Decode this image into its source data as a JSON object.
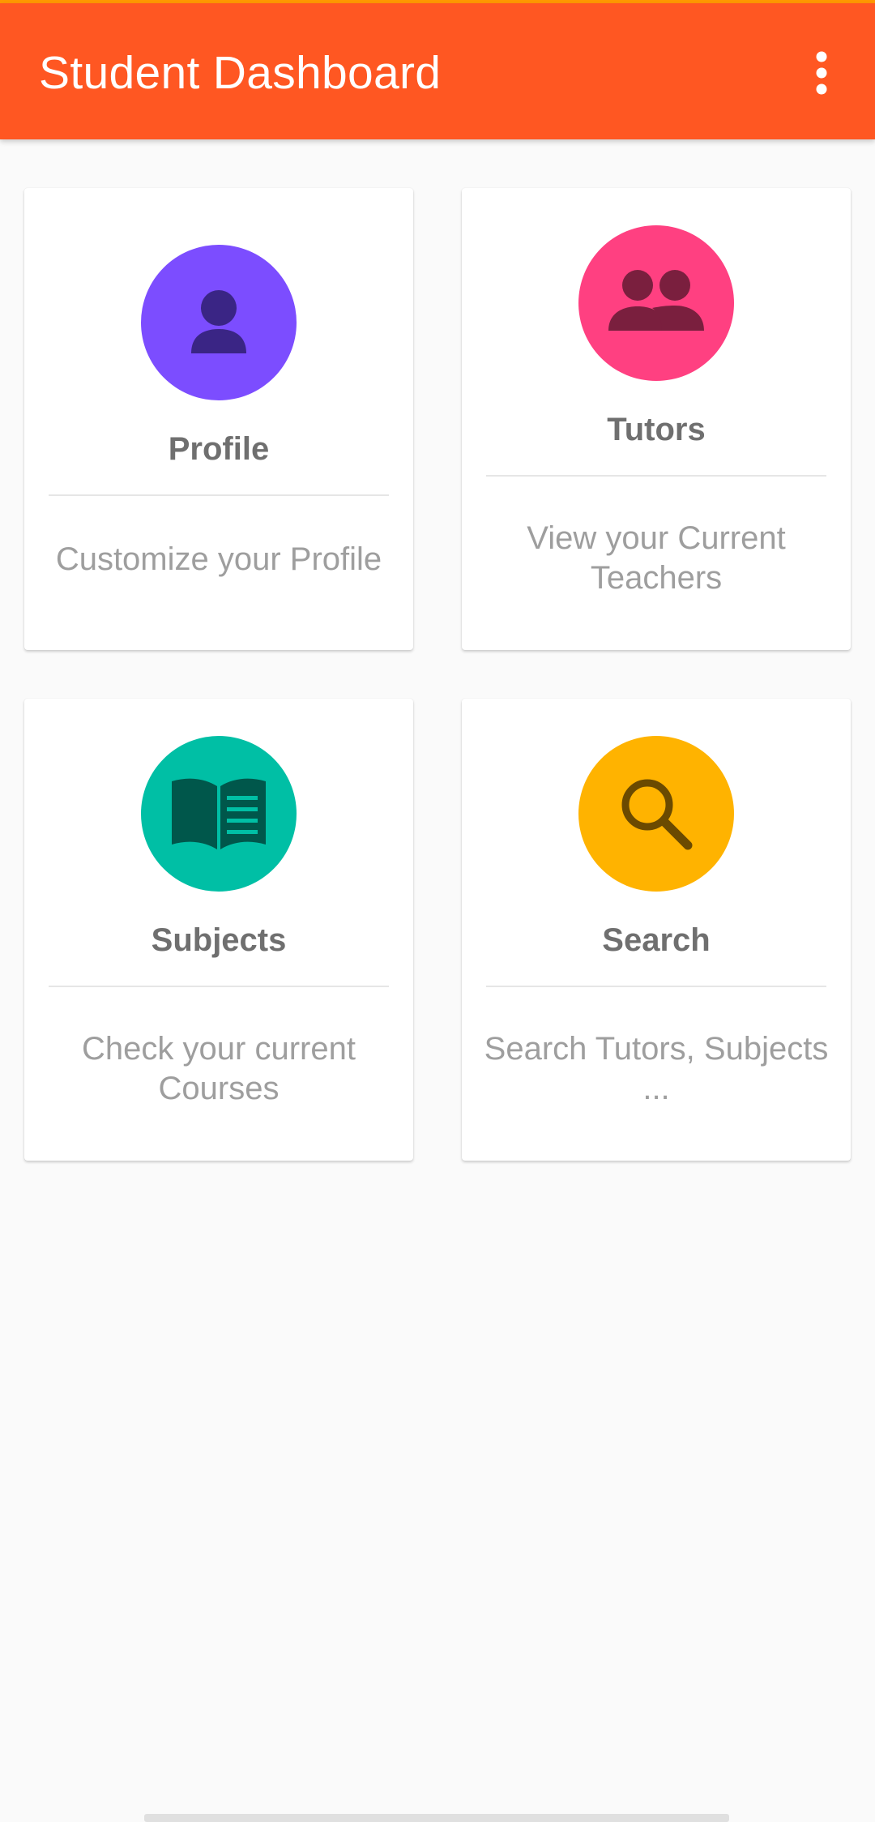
{
  "appbar": {
    "title": "Student Dashboard",
    "menu_icon": "more-vertical-icon"
  },
  "colors": {
    "appbar": "#ff5722",
    "status_line": "#ff9800",
    "profile": "#7c4dff",
    "tutors": "#ff4081",
    "subjects": "#00bfa5",
    "search": "#ffb300"
  },
  "cards": [
    {
      "label": "Profile",
      "description": "Customize your Profile",
      "icon": "person-icon"
    },
    {
      "label": "Tutors",
      "description": "View your Current Teachers",
      "icon": "group-icon"
    },
    {
      "label": "Subjects",
      "description": "Check your current Courses",
      "icon": "book-icon"
    },
    {
      "label": "Search",
      "description": "Search Tutors, Subjects ...",
      "icon": "search-icon"
    }
  ]
}
